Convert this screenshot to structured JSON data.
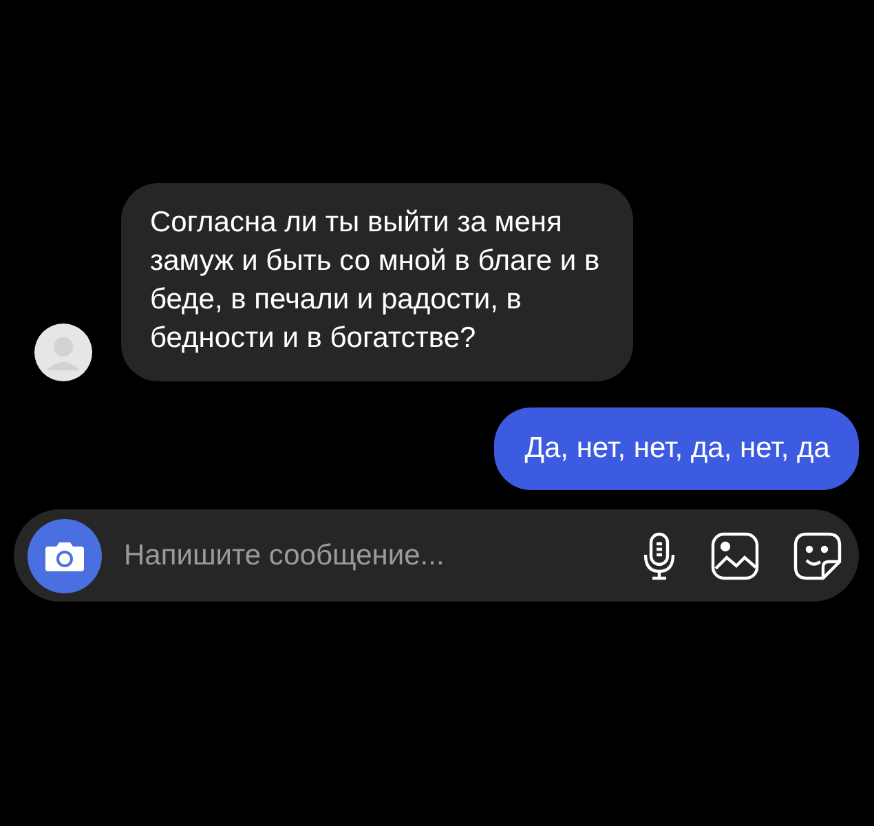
{
  "messages": [
    {
      "kind": "incoming",
      "text": "Согласна ли ты выйти за меня\nзамуж и быть со мной в благе и в\nбеде, в печали и радости, в\nбедности и в богатстве?"
    },
    {
      "kind": "outgoing",
      "text": "Да, нет, нет, да, нет, да"
    }
  ],
  "composer": {
    "placeholder": "Напишите сообщение..."
  }
}
